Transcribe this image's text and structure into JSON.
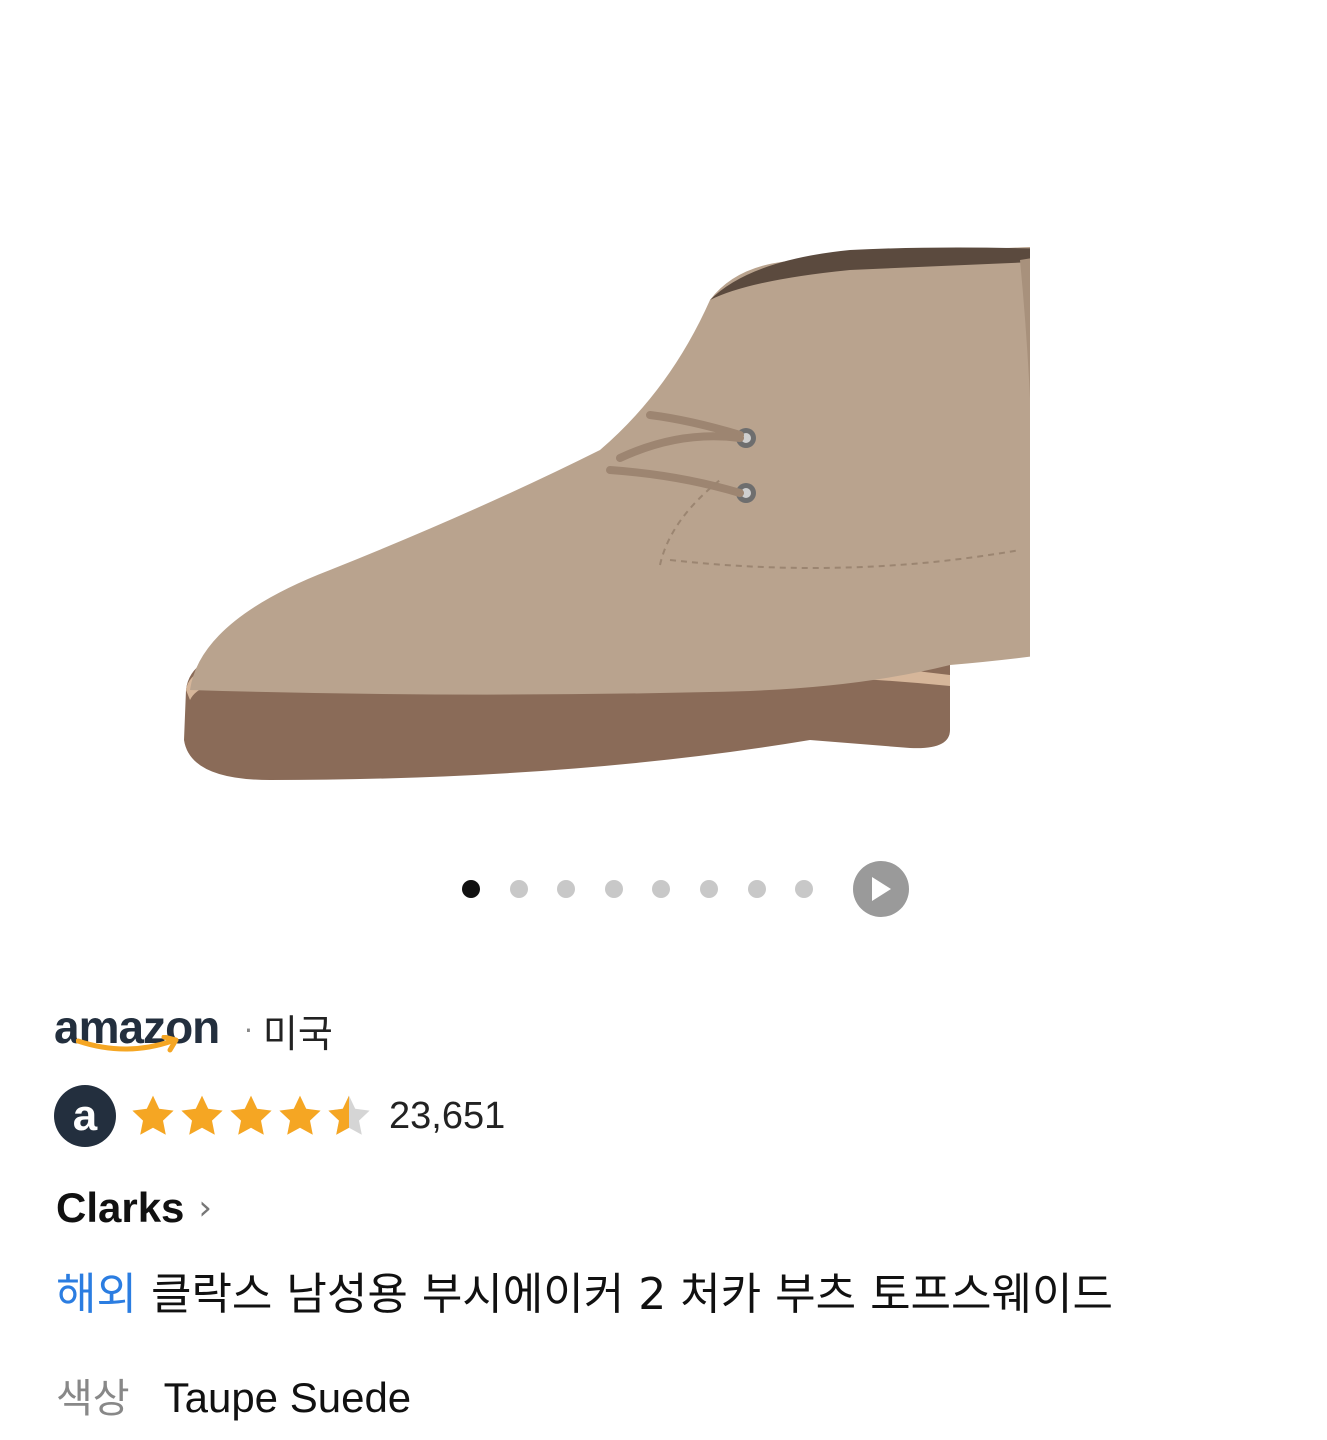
{
  "gallery": {
    "image_alt": "Clarks taupe suede chukka boot",
    "total_images": 8,
    "active_index": 0
  },
  "seller": {
    "logo_text": "amazon",
    "separator": "·",
    "country": "미국"
  },
  "rating": {
    "badge_letter": "a",
    "stars": 4.5,
    "review_count": "23,651",
    "colors": {
      "star_filled": "#f5a623",
      "star_empty": "#d5d5d5",
      "badge": "#232f3e"
    }
  },
  "brand": {
    "name": "Clarks",
    "chevron": "›"
  },
  "product": {
    "overseas_tag": "해외",
    "title": "클락스 남성용 부시에이커 2 처카 부츠 토프스웨이드",
    "tag_color": "#2b7de1"
  },
  "option": {
    "label": "색상",
    "value": "Taupe Suede"
  }
}
